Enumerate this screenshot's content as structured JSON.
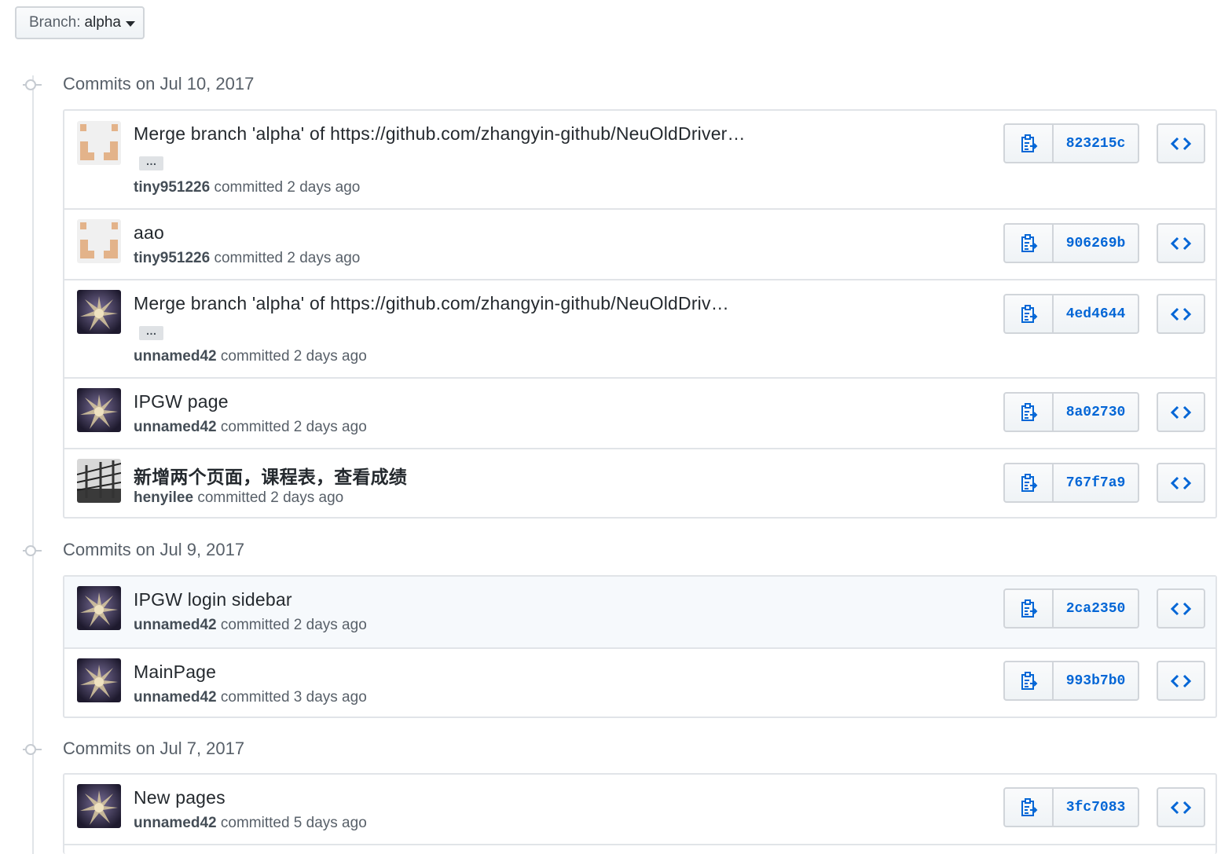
{
  "branch": {
    "prefix": "Branch:",
    "value": "alpha"
  },
  "colors": {
    "link": "#0366d6",
    "muted": "#586069",
    "border": "#e1e4e8",
    "highlight_row": "#f6f9fc"
  },
  "groups": [
    {
      "date_label": "Commits on Jul 10, 2017",
      "commits": [
        {
          "message": "Merge branch 'alpha' of https://github.com/zhangyin-github/NeuOldDriver…",
          "has_ellipsis": true,
          "ellipsis_label": "…",
          "author": "tiny951226",
          "action": "committed",
          "when": "2 days ago",
          "sha": "823215c",
          "avatar": "identicon-icon"
        },
        {
          "message": "aao",
          "has_ellipsis": false,
          "author": "tiny951226",
          "action": "committed",
          "when": "2 days ago",
          "sha": "906269b",
          "avatar": "identicon-icon"
        },
        {
          "message": "Merge branch 'alpha' of https://github.com/zhangyin-github/NeuOldDriv…",
          "has_ellipsis": true,
          "ellipsis_label": "…",
          "author": "unnamed42",
          "action": "committed",
          "when": "2 days ago",
          "sha": "4ed4644",
          "avatar": "robot-avatar-icon"
        },
        {
          "message": "IPGW page",
          "has_ellipsis": false,
          "author": "unnamed42",
          "action": "committed",
          "when": "2 days ago",
          "sha": "8a02730",
          "avatar": "robot-avatar-icon"
        },
        {
          "message": "新增两个页面，课程表，查看成绩",
          "has_ellipsis": false,
          "author": "henyilee",
          "action": "committed",
          "when": "2 days ago",
          "sha": "767f7a9",
          "avatar": "photo-avatar-icon"
        }
      ]
    },
    {
      "date_label": "Commits on Jul 9, 2017",
      "commits": [
        {
          "message": "IPGW login sidebar",
          "has_ellipsis": false,
          "author": "unnamed42",
          "action": "committed",
          "when": "2 days ago",
          "sha": "2ca2350",
          "avatar": "robot-avatar-icon"
        },
        {
          "message": "MainPage",
          "has_ellipsis": false,
          "author": "unnamed42",
          "action": "committed",
          "when": "3 days ago",
          "sha": "993b7b0",
          "avatar": "robot-avatar-icon"
        }
      ]
    },
    {
      "date_label": "Commits on Jul 7, 2017",
      "commits": [
        {
          "message": "New pages",
          "has_ellipsis": false,
          "author": "unnamed42",
          "action": "committed",
          "when": "5 days ago",
          "sha": "3fc7083",
          "avatar": "robot-avatar-icon"
        }
      ]
    }
  ],
  "icons": {
    "copy": "clipboard-copy-icon",
    "browse": "code-brackets-icon"
  }
}
